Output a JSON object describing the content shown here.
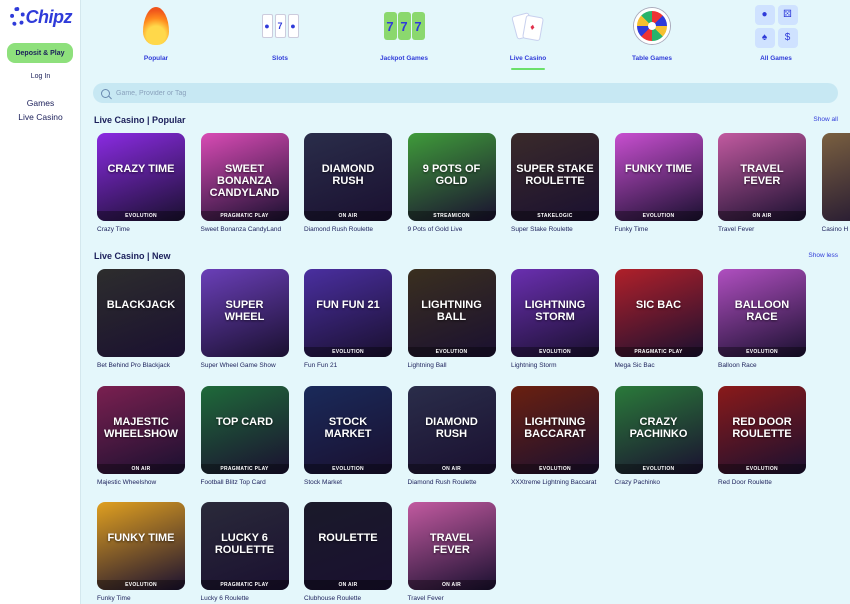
{
  "sidebar": {
    "logo": "Chipz",
    "deposit_label": "Deposit & Play",
    "login_label": "Log In",
    "nav": [
      "Games",
      "Live Casino"
    ]
  },
  "categories": [
    {
      "label": "Popular",
      "icon": "flame-icon"
    },
    {
      "label": "Slots",
      "icon": "slot-icon"
    },
    {
      "label": "Jackpot Games",
      "icon": "jackpot-icon"
    },
    {
      "label": "Live Casino",
      "icon": "live-cards-icon",
      "active": true
    },
    {
      "label": "Table Games",
      "icon": "roulette-wheel-icon"
    },
    {
      "label": "All Games",
      "icon": "all-games-icon"
    }
  ],
  "search": {
    "placeholder": "Game, Provider or Tag"
  },
  "popular": {
    "title": "Live Casino | Popular",
    "link": "Show all",
    "games": [
      {
        "name": "Crazy Time",
        "art": "CRAZY TIME",
        "provider": "EVOLUTION",
        "color": "#8a2be2"
      },
      {
        "name": "Sweet Bonanza CandyLand",
        "art": "SWEET BONANZA CANDYLAND",
        "provider": "PRAGMATIC PLAY",
        "color": "#d94bb5"
      },
      {
        "name": "Diamond Rush Roulette",
        "art": "DIAMOND RUSH",
        "provider": "ON AIR",
        "color": "#2a2d4a"
      },
      {
        "name": "9 Pots of Gold Live",
        "art": "9 POTS OF GOLD",
        "provider": "STREAMICON",
        "color": "#3f9b3a"
      },
      {
        "name": "Super Stake Roulette",
        "art": "SUPER STAKE ROULETTE",
        "provider": "STAKELOGIC",
        "color": "#3a2a2a"
      },
      {
        "name": "Funky Time",
        "art": "FUNKY TIME",
        "provider": "EVOLUTION",
        "color": "#c84fd0"
      },
      {
        "name": "Travel Fever",
        "art": "TRAVEL FEVER",
        "provider": "ON AIR",
        "color": "#c25aa0"
      },
      {
        "name": "Casino H",
        "art": "",
        "provider": "",
        "color": "#7a6040"
      }
    ]
  },
  "new": {
    "title": "Live Casino | New",
    "link": "Show less",
    "games": [
      {
        "name": "Bet Behind Pro Blackjack",
        "art": "BLACKJACK",
        "provider": "",
        "color": "#2d2d2d"
      },
      {
        "name": "Super Wheel Game Show",
        "art": "SUPER WHEEL",
        "provider": "",
        "color": "#6a3fb8"
      },
      {
        "name": "Fun Fun 21",
        "art": "FUN FUN 21",
        "provider": "EVOLUTION",
        "color": "#4a2fa0"
      },
      {
        "name": "Lightning Ball",
        "art": "LIGHTNING BALL",
        "provider": "EVOLUTION",
        "color": "#3a2f1f"
      },
      {
        "name": "Lightning Storm",
        "art": "LIGHTNING STORM",
        "provider": "EVOLUTION",
        "color": "#6a2fb0"
      },
      {
        "name": "Mega Sic Bac",
        "art": "SIC BAC",
        "provider": "PRAGMATIC PLAY",
        "color": "#b0202a"
      },
      {
        "name": "Balloon Race",
        "art": "BALLOON RACE",
        "provider": "EVOLUTION",
        "color": "#b04fc0"
      },
      {
        "name": "Majestic Wheelshow",
        "art": "MAJESTIC WHEELSHOW",
        "provider": "ON AIR",
        "color": "#7a2050"
      },
      {
        "name": "Football Blitz Top Card",
        "art": "TOP CARD",
        "provider": "PRAGMATIC PLAY",
        "color": "#1f6a3a"
      },
      {
        "name": "Stock Market",
        "art": "STOCK MARKET",
        "provider": "EVOLUTION",
        "color": "#1a2a5a"
      },
      {
        "name": "Diamond Rush Roulette",
        "art": "DIAMOND RUSH",
        "provider": "ON AIR",
        "color": "#2a2d4a"
      },
      {
        "name": "XXXtreme Lightning Baccarat",
        "art": "LIGHTNING BACCARAT",
        "provider": "EVOLUTION",
        "color": "#6a2010"
      },
      {
        "name": "Crazy Pachinko",
        "art": "CRAZY PACHINKO",
        "provider": "EVOLUTION",
        "color": "#2a7a3a"
      },
      {
        "name": "Red Door Roulette",
        "art": "RED DOOR ROULETTE",
        "provider": "EVOLUTION",
        "color": "#8a1a1a"
      },
      {
        "name": "Funky Time",
        "art": "FUNKY TIME",
        "provider": "EVOLUTION",
        "color": "#e0a020"
      },
      {
        "name": "Lucky 6 Roulette",
        "art": "LUCKY 6 ROULETTE",
        "provider": "PRAGMATIC PLAY",
        "color": "#2a2a3a"
      },
      {
        "name": "Clubhouse Roulette",
        "art": "ROULETTE",
        "provider": "ON AIR",
        "color": "#1a1a2a"
      },
      {
        "name": "Travel Fever",
        "art": "TRAVEL FEVER",
        "provider": "ON AIR",
        "color": "#c25aa0"
      }
    ]
  }
}
